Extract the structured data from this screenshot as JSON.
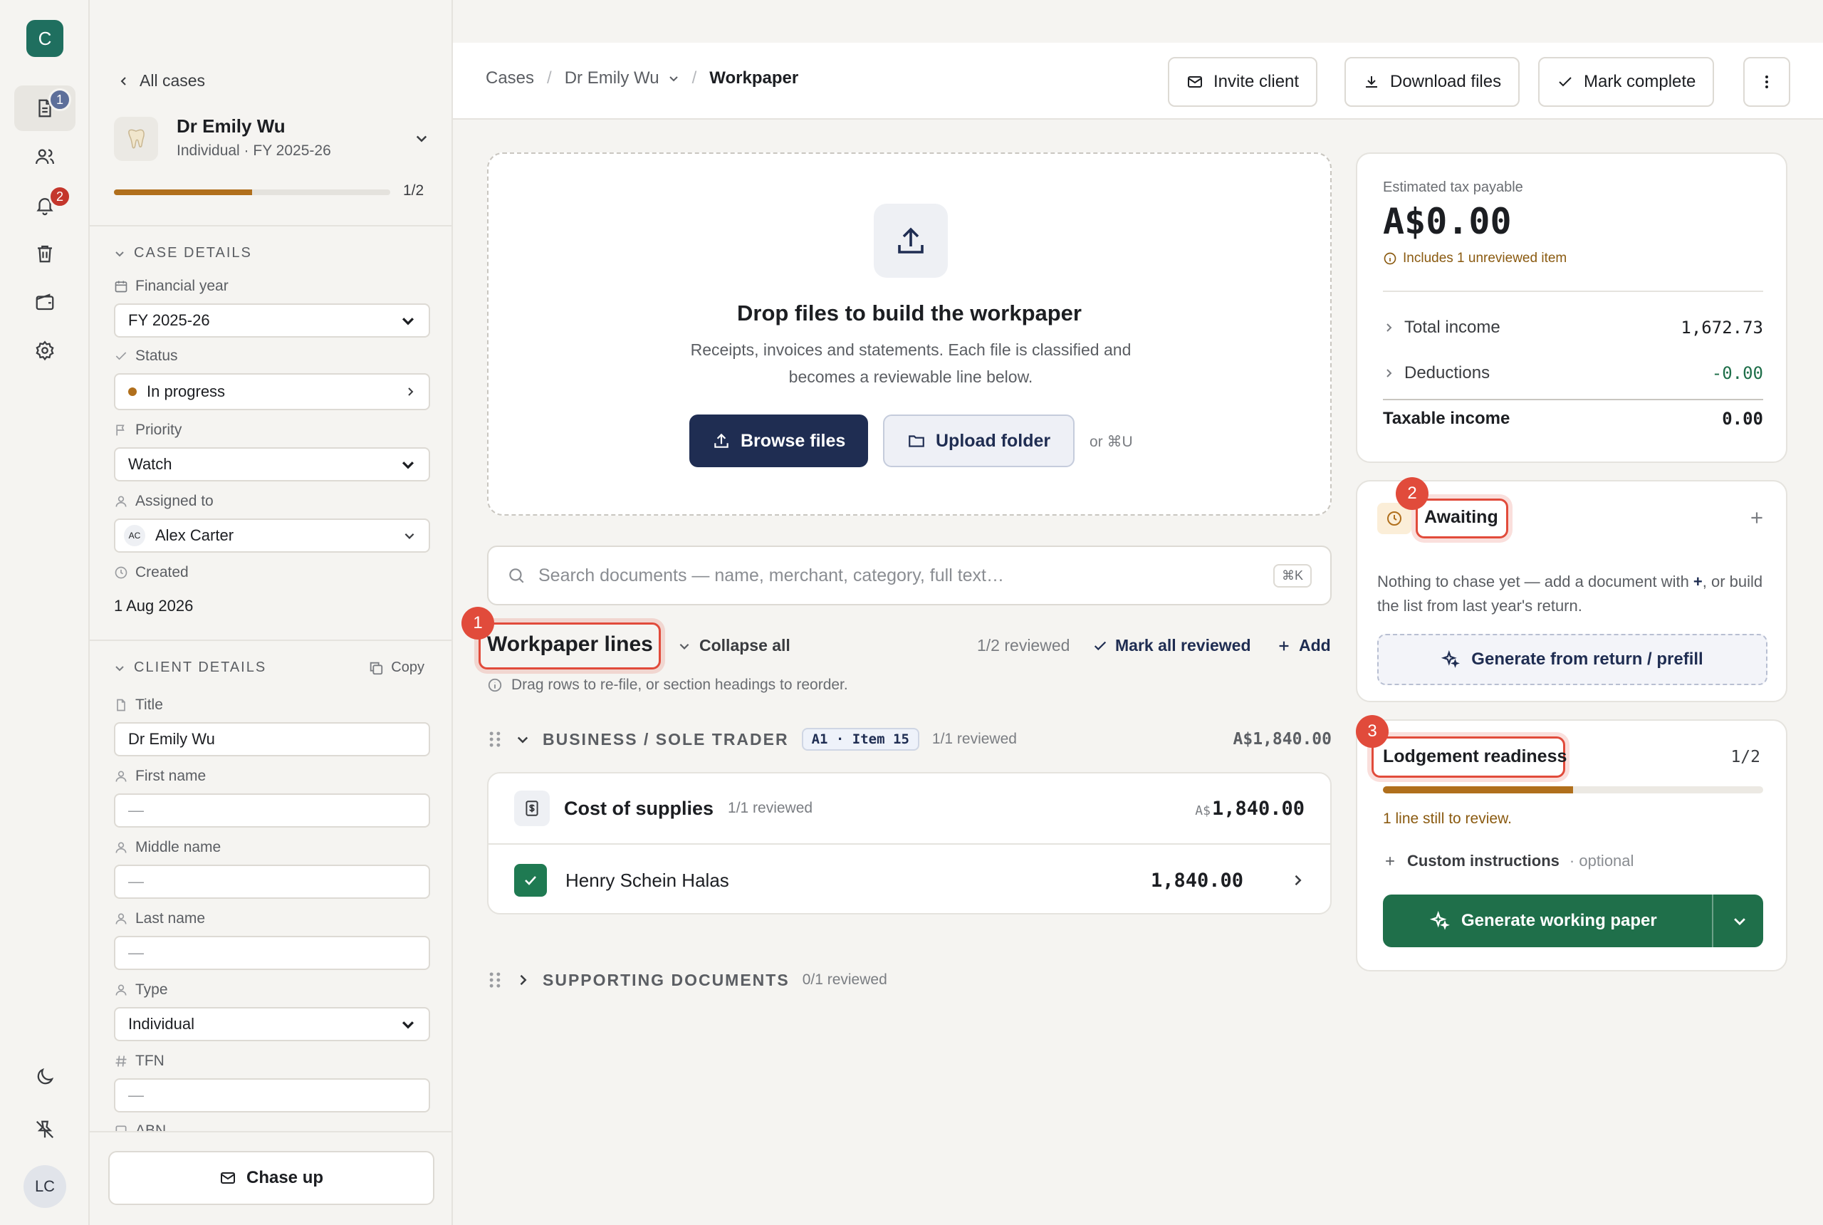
{
  "app": {
    "logo_letter": "C",
    "docs_badge": "1",
    "alerts_badge": "2",
    "user_initials": "LC"
  },
  "side": {
    "back_label": "All cases",
    "case_name": "Dr Emily Wu",
    "case_sub": "Individual · FY 2025-26",
    "progress_text": "1/2",
    "progress_fraction": 0.5,
    "case_details": {
      "heading": "CASE DETAILS",
      "financial_year_label": "Financial year",
      "financial_year": "FY 2025-26",
      "status_label": "Status",
      "status": "In progress",
      "priority_label": "Priority",
      "priority": "Watch",
      "assigned_label": "Assigned to",
      "assigned_initials": "AC",
      "assigned": "Alex Carter",
      "created_label": "Created",
      "created": "1 Aug 2026"
    },
    "client_details": {
      "heading": "CLIENT DETAILS",
      "copy_label": "Copy",
      "title_label": "Title",
      "title": "Dr Emily Wu",
      "first_label": "First name",
      "first": "—",
      "middle_label": "Middle name",
      "middle": "—",
      "last_label": "Last name",
      "last": "—",
      "type_label": "Type",
      "type": "Individual",
      "tfn_label": "TFN",
      "tfn": "—",
      "abn_label": "ABN"
    },
    "chase_label": "Chase up"
  },
  "topbar": {
    "crumb1": "Cases",
    "crumb2": "Dr Emily Wu",
    "crumb3": "Workpaper",
    "invite": "Invite client",
    "download": "Download files",
    "complete": "Mark complete"
  },
  "drop": {
    "title": "Drop files to build the workpaper",
    "desc": "Receipts, invoices and statements. Each file is classified and becomes a reviewable line below.",
    "browse": "Browse files",
    "upload": "Upload folder",
    "shortcut": "or ⌘U"
  },
  "search": {
    "placeholder": "Search documents — name, merchant, category, full text…",
    "kbd": "⌘K"
  },
  "workpaper": {
    "marker": "1",
    "title": "Workpaper lines",
    "collapse": "Collapse all",
    "reviewed": "1/2 reviewed",
    "mark_all": "Mark all reviewed",
    "add": "Add",
    "hint": "Drag rows to re-file, or section headings to reorder.",
    "group1": {
      "name": "BUSINESS / SOLE TRADER",
      "tag": "A1 · Item 15",
      "reviewed": "1/1 reviewed",
      "total": "A$1,840.00"
    },
    "cat": {
      "name": "Cost of supplies",
      "reviewed": "1/1 reviewed",
      "currency": "A$",
      "amount": "1,840.00"
    },
    "line": {
      "name": "Henry Schein Halas",
      "amount": "1,840.00"
    },
    "group2": {
      "name": "SUPPORTING DOCUMENTS",
      "reviewed": "0/1 reviewed"
    }
  },
  "tax": {
    "label": "Estimated tax payable",
    "value": "A$0.00",
    "note": "Includes 1 unreviewed item",
    "income_label": "Total income",
    "income": "1,672.73",
    "deductions_label": "Deductions",
    "deductions": "-0.00",
    "taxable_label": "Taxable income",
    "taxable": "0.00"
  },
  "awaiting": {
    "marker": "2",
    "title": "Awaiting",
    "desc_a": "Nothing to chase yet — add a document with ",
    "desc_plus": "+",
    "desc_b": ", or build the list from last year's return.",
    "generate": "Generate from return / prefill"
  },
  "lodge": {
    "marker": "3",
    "title": "Lodgement readiness",
    "count": "1/2",
    "progress_fraction": 0.5,
    "note": "1 line still to review.",
    "custom": "Custom instructions",
    "optional": "· optional",
    "generate": "Generate working paper"
  },
  "colors": {
    "accent_navy": "#1f2d52",
    "green": "#1f6f4a",
    "amber": "#b06f1c",
    "marker_red": "#e14b3b",
    "teal_logo": "#1f6f5f"
  }
}
